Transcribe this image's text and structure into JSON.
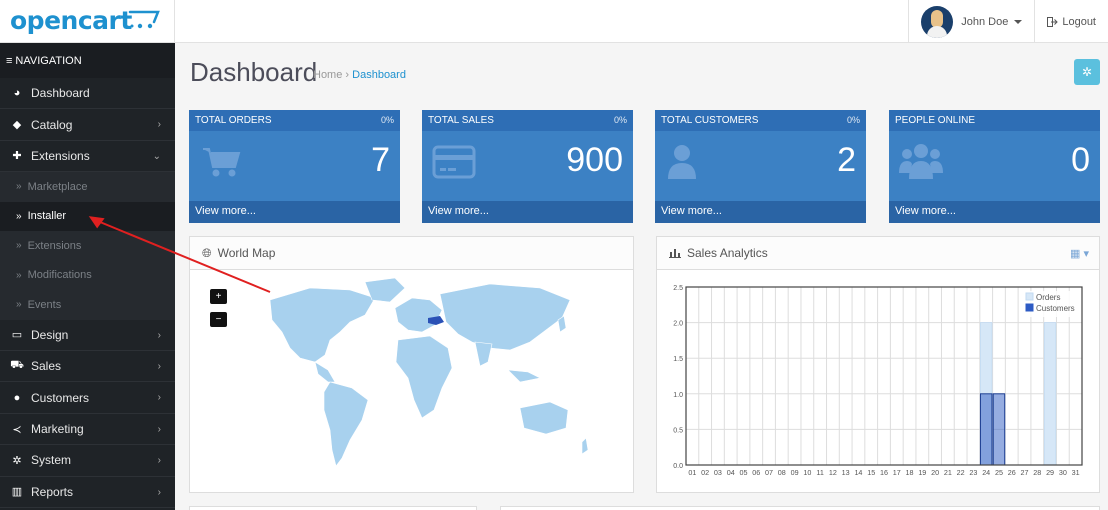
{
  "header": {
    "logo_text": "opencart",
    "user_name": "John Doe",
    "logout_label": "Logout"
  },
  "sidebar": {
    "heading": "NAVIGATION",
    "items": [
      {
        "label": "Dashboard",
        "icon": "dashboard-icon",
        "has_chevron": false
      },
      {
        "label": "Catalog",
        "icon": "tag-icon",
        "has_chevron": true
      },
      {
        "label": "Extensions",
        "icon": "puzzle-icon",
        "has_chevron": true,
        "expanded": true
      }
    ],
    "sub_items": [
      {
        "label": "Marketplace",
        "active": false
      },
      {
        "label": "Installer",
        "active": true
      },
      {
        "label": "Extensions",
        "active": false
      },
      {
        "label": "Modifications",
        "active": false
      },
      {
        "label": "Events",
        "active": false
      }
    ],
    "items_after": [
      {
        "label": "Design",
        "icon": "monitor-icon"
      },
      {
        "label": "Sales",
        "icon": "cart-icon"
      },
      {
        "label": "Customers",
        "icon": "user-icon"
      },
      {
        "label": "Marketing",
        "icon": "share-icon"
      },
      {
        "label": "System",
        "icon": "gear-icon"
      },
      {
        "label": "Reports",
        "icon": "bar-chart-icon"
      }
    ]
  },
  "page": {
    "title": "Dashboard",
    "breadcrumb_home": "Home",
    "breadcrumb_sep": "›",
    "breadcrumb_current": "Dashboard"
  },
  "tiles": [
    {
      "title": "TOTAL ORDERS",
      "percent": "0%",
      "value": "7",
      "link": "View more...",
      "icon": "cart-icon"
    },
    {
      "title": "TOTAL SALES",
      "percent": "0%",
      "value": "900",
      "link": "View more...",
      "icon": "credit-card-icon"
    },
    {
      "title": "TOTAL CUSTOMERS",
      "percent": "0%",
      "value": "2",
      "link": "View more...",
      "icon": "user-icon"
    },
    {
      "title": "PEOPLE ONLINE",
      "percent": "",
      "value": "0",
      "link": "View more...",
      "icon": "users-icon"
    }
  ],
  "map": {
    "title": "World Map",
    "zoom_in": "+",
    "zoom_out": "−",
    "land_color": "#a8d1ee",
    "highlight_color": "#2a51b6"
  },
  "chart_data": {
    "type": "bar",
    "title": "Sales Analytics",
    "categories": [
      "01",
      "02",
      "03",
      "04",
      "05",
      "06",
      "07",
      "08",
      "09",
      "10",
      "11",
      "12",
      "13",
      "14",
      "15",
      "16",
      "17",
      "18",
      "19",
      "20",
      "21",
      "22",
      "23",
      "24",
      "25",
      "26",
      "27",
      "28",
      "29",
      "30",
      "31"
    ],
    "series": [
      {
        "name": "Orders",
        "color": "#d6e7f7",
        "values": [
          0,
          0,
          0,
          0,
          0,
          0,
          0,
          0,
          0,
          0,
          0,
          0,
          0,
          0,
          0,
          0,
          0,
          0,
          0,
          0,
          0,
          0,
          0,
          2,
          0,
          0,
          0,
          0,
          2,
          0,
          0
        ]
      },
      {
        "name": "Customers",
        "color": "#2d5bc4",
        "values": [
          0,
          0,
          0,
          0,
          0,
          0,
          0,
          0,
          0,
          0,
          0,
          0,
          0,
          0,
          0,
          0,
          0,
          0,
          0,
          0,
          0,
          0,
          0,
          1,
          1,
          0,
          0,
          0,
          0,
          0,
          0
        ]
      }
    ],
    "yticks": [
      "0.0",
      "0.5",
      "1.0",
      "1.5",
      "2.0",
      "2.5"
    ],
    "ylim": [
      0,
      2.5
    ],
    "legend_position": "top-right",
    "grid": true
  },
  "colors": {
    "brand": "#1e91cf",
    "tile": "#3c81c4",
    "sidebar": "#1f2327",
    "annotation_arrow": "#e02020"
  }
}
